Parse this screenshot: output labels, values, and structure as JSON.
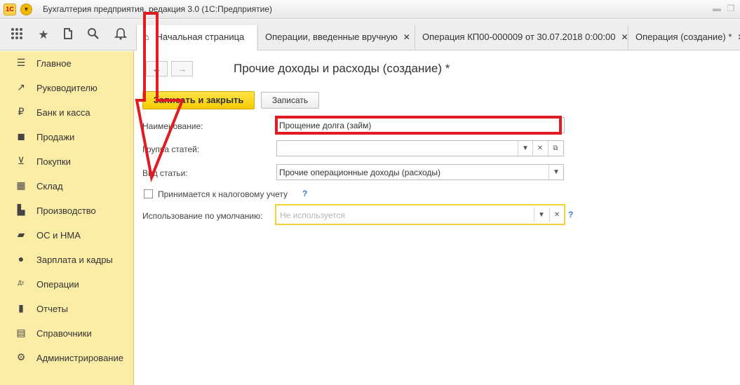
{
  "titlebar": {
    "logo": "1С",
    "title": "Бухгалтерия предприятия, редакция 3.0  (1С:Предприятие)"
  },
  "toolbar": {
    "icons": [
      "apps-grid-icon",
      "star-icon",
      "history-icon",
      "search-icon",
      "bell-icon"
    ]
  },
  "tabs": [
    {
      "label": "Начальная страница",
      "closable": false
    },
    {
      "label": "Операции, введенные вручную",
      "closable": true
    },
    {
      "label": "Операция КП00-000009 от 30.07.2018 0:00:00",
      "closable": true
    },
    {
      "label": "Операция (создание) *",
      "closable": true
    }
  ],
  "sidebar": {
    "items": [
      {
        "label": "Главное",
        "icon": "menu-icon"
      },
      {
        "label": "Руководителю",
        "icon": "trend-icon"
      },
      {
        "label": "Банк и касса",
        "icon": "ruble-icon"
      },
      {
        "label": "Продажи",
        "icon": "bag-icon"
      },
      {
        "label": "Покупки",
        "icon": "cart-icon"
      },
      {
        "label": "Склад",
        "icon": "warehouse-icon"
      },
      {
        "label": "Производство",
        "icon": "factory-icon"
      },
      {
        "label": "ОС и НМА",
        "icon": "truck-icon"
      },
      {
        "label": "Зарплата и кадры",
        "icon": "person-icon"
      },
      {
        "label": "Операции",
        "icon": "dt-kt-icon"
      },
      {
        "label": "Отчеты",
        "icon": "bar-chart-icon"
      },
      {
        "label": "Справочники",
        "icon": "book-icon"
      },
      {
        "label": "Администрирование",
        "icon": "gear-icon"
      }
    ]
  },
  "form": {
    "title": "Прочие доходы и расходы (создание) *",
    "save_close_label": "Записать и закрыть",
    "save_label": "Записать",
    "name_label": "Наименование:",
    "name_value": "Прощение долга (займ)",
    "group_label": "Группа статей:",
    "group_value": "",
    "type_label": "Вид статьи:",
    "type_value": "Прочие операционные доходы (расходы)",
    "tax_label": "Принимается к налоговому учету",
    "tax_checked": false,
    "usage_label": "Использование по умолчанию:",
    "usage_placeholder": "Не используется",
    "help_mark": "?"
  },
  "colors": {
    "sidebar_bg": "#fbeca6",
    "primary_button": "#f7cb00",
    "annotation": "#e11b22",
    "active_field_border": "#f2d13a"
  }
}
